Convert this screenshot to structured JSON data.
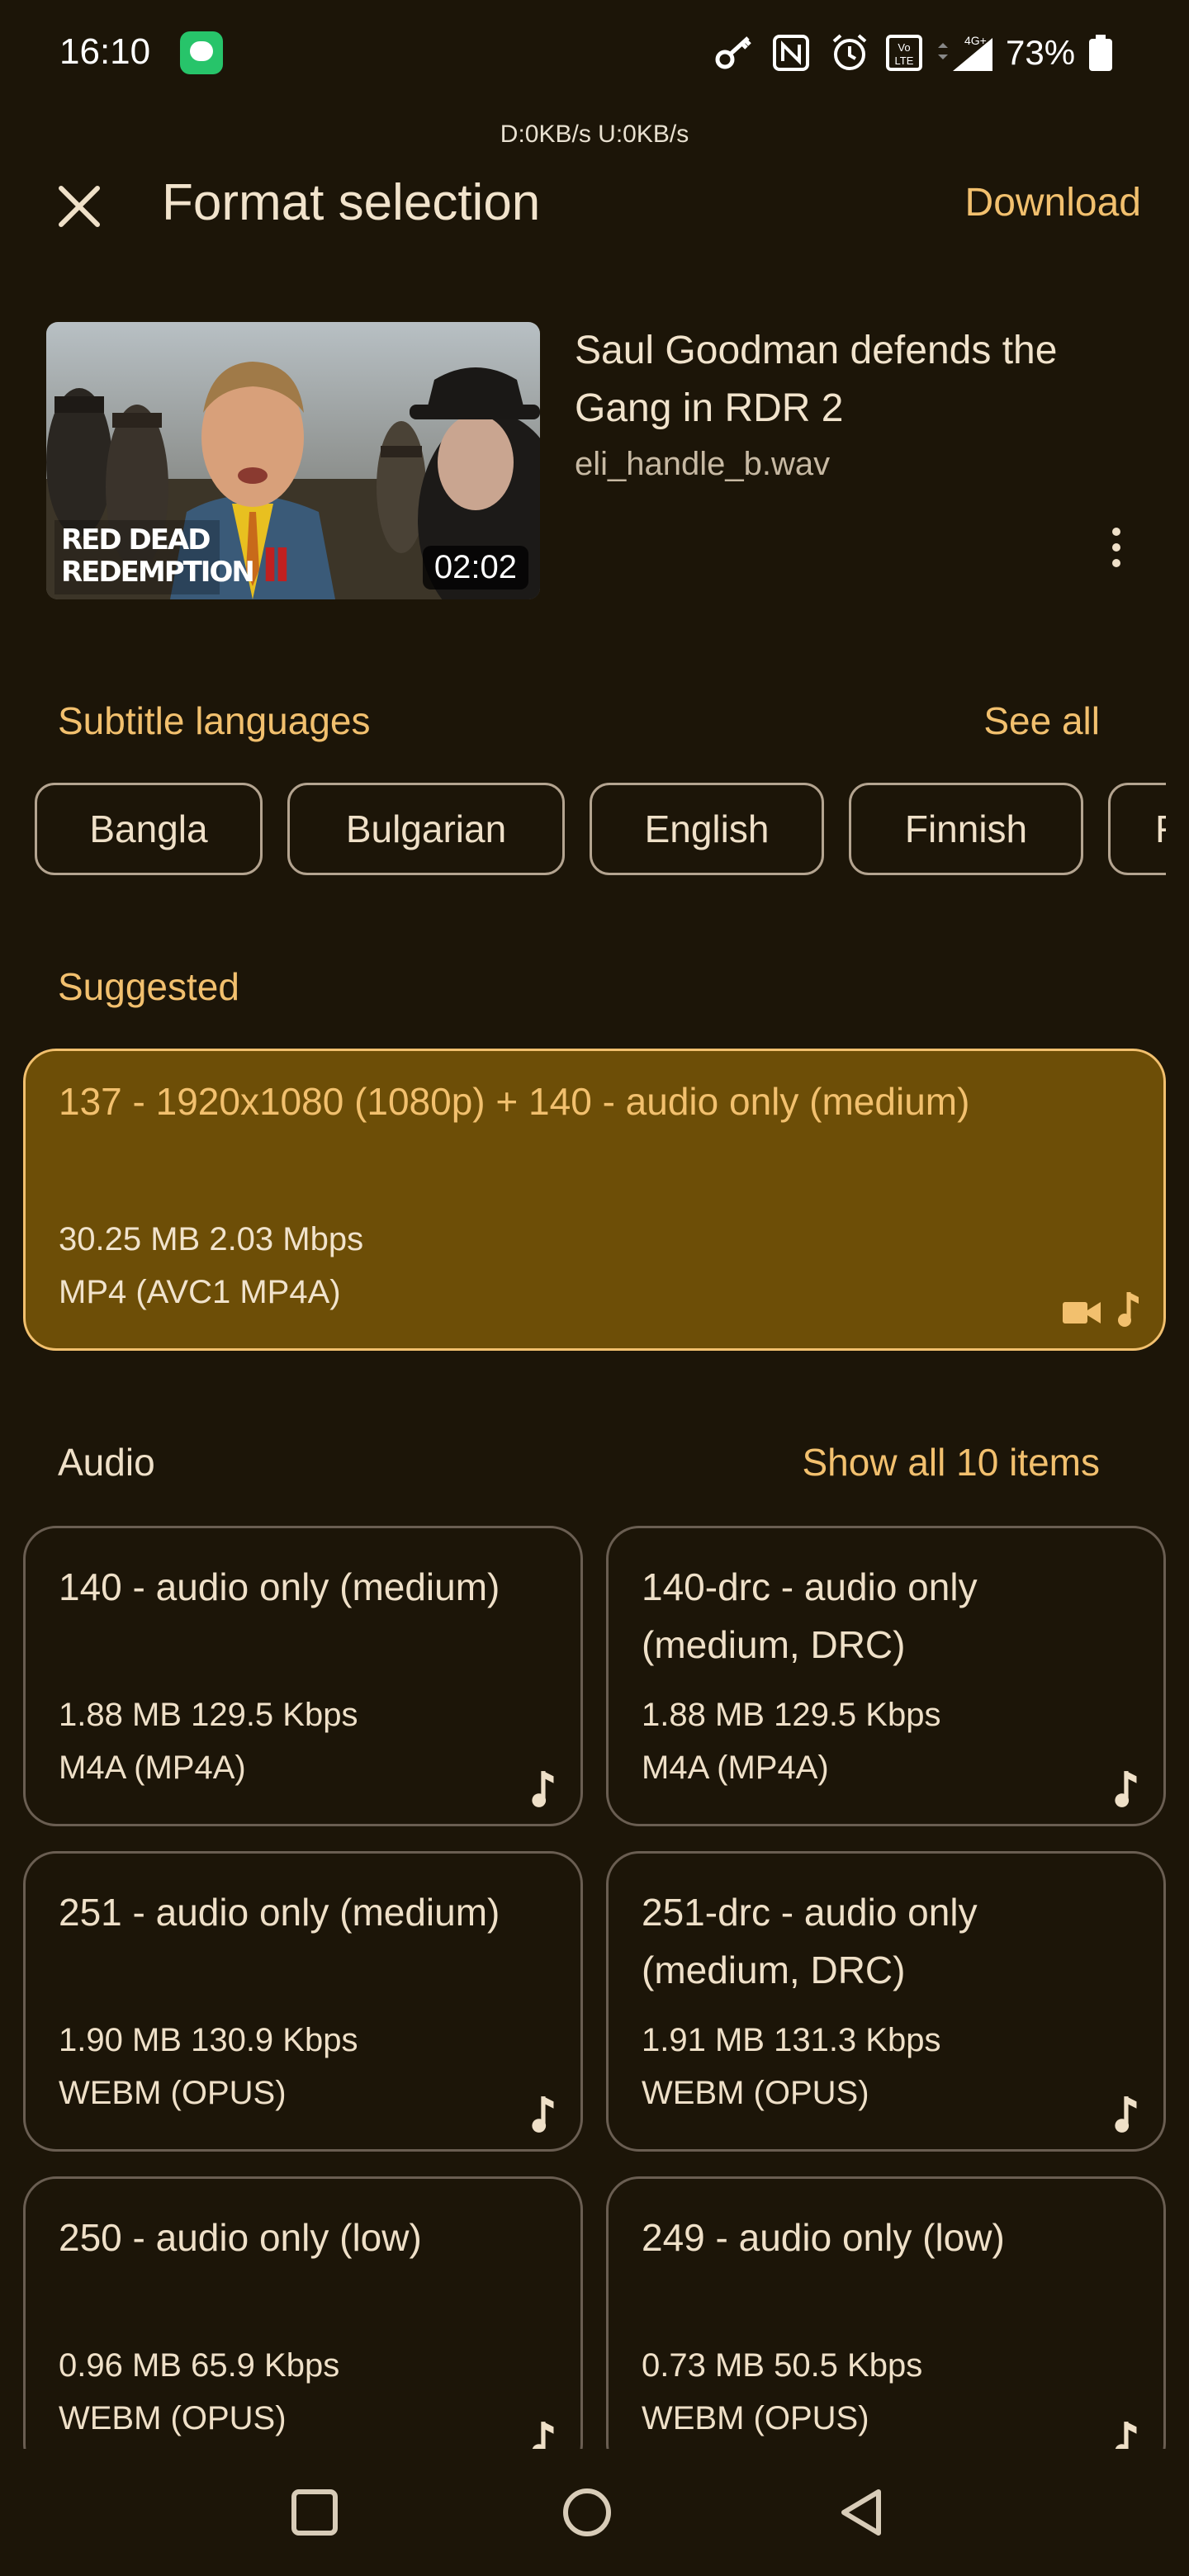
{
  "status_bar": {
    "time": "16:10",
    "battery": "73%",
    "net_speed": "D:0KB/s   U:0KB/s",
    "icons": [
      "chat-app-icon",
      "key-icon",
      "nfc-icon",
      "alarm-icon",
      "volte-icon",
      "signal-4g-icon",
      "battery-icon"
    ]
  },
  "header": {
    "title": "Format selection",
    "download_label": "Download"
  },
  "video": {
    "title": "Saul Goodman defends the Gang in RDR 2",
    "filename": "eli_handle_b.wav",
    "duration": "02:02",
    "thumbnail_logo": "RED DEAD REDEMPTION II"
  },
  "subtitles": {
    "section_label": "Subtitle languages",
    "see_all_label": "See all",
    "languages": [
      "Bangla",
      "Bulgarian",
      "English",
      "Finnish",
      "F"
    ]
  },
  "suggested": {
    "section_label": "Suggested",
    "title": "137 - 1920x1080 (1080p) + 140 - audio only (medium)",
    "size_bitrate": "30.25 MB 2.03 Mbps",
    "codec": "MP4 (AVC1 MP4A)"
  },
  "audio": {
    "section_label": "Audio",
    "show_all_label": "Show all 10 items",
    "items": [
      {
        "title": "140 - audio only (medium)",
        "size_bitrate": "1.88 MB 129.5 Kbps",
        "codec": "M4A (MP4A)"
      },
      {
        "title": "140-drc - audio only (medium, DRC)",
        "size_bitrate": "1.88 MB 129.5 Kbps",
        "codec": "M4A (MP4A)"
      },
      {
        "title": "251 - audio only (medium)",
        "size_bitrate": "1.90 MB 130.9 Kbps",
        "codec": "WEBM (OPUS)"
      },
      {
        "title": "251-drc - audio only (medium, DRC)",
        "size_bitrate": "1.91 MB 131.3 Kbps",
        "codec": "WEBM (OPUS)"
      },
      {
        "title": "250 - audio only (low)",
        "size_bitrate": "0.96 MB 65.9 Kbps",
        "codec": "WEBM (OPUS)"
      },
      {
        "title": "249 - audio only (low)",
        "size_bitrate": "0.73 MB 50.5 Kbps",
        "codec": "WEBM (OPUS)"
      }
    ]
  },
  "colors": {
    "background": "#1c1508",
    "accent": "#f2c06e",
    "suggested_fill": "#6d4e07",
    "text": "#efe0c8"
  }
}
